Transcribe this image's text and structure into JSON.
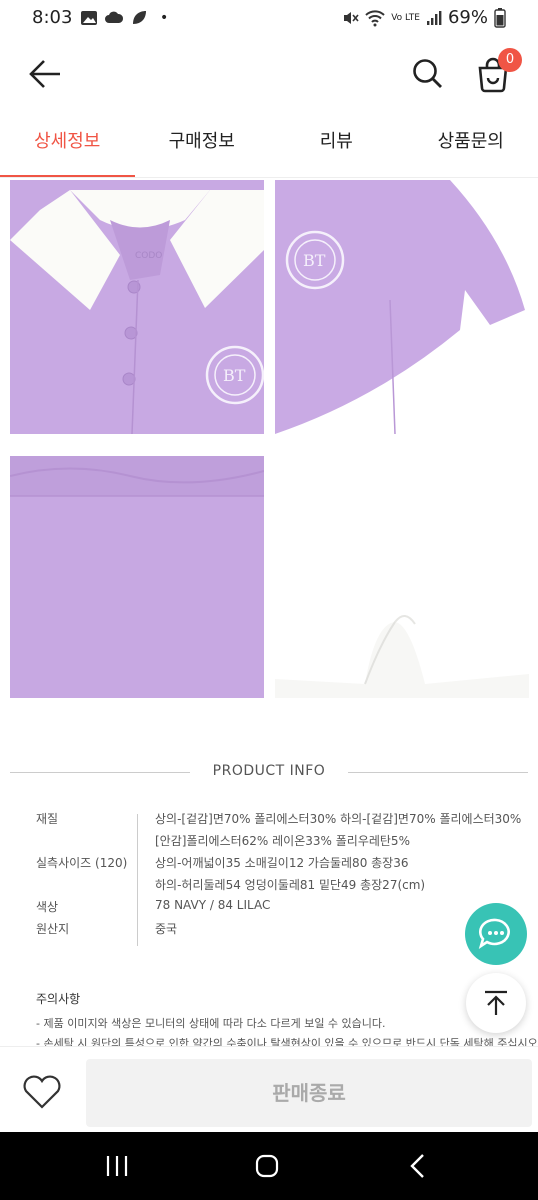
{
  "status_bar": {
    "time": "8:03",
    "dot": "•",
    "battery": "69%",
    "network": "Vo LTE",
    "icons": [
      "gallery-icon",
      "cloud-icon",
      "leaf-icon",
      "mute-icon",
      "wifi-icon",
      "signal-icon",
      "battery-icon"
    ]
  },
  "header": {
    "back_icon": "arrow-left-icon",
    "search_icon": "search-icon",
    "cart_icon": "shopping-bag-icon",
    "cart_count": "0"
  },
  "tabs": [
    {
      "label": "상세정보",
      "active": true
    },
    {
      "label": "구매정보",
      "active": false
    },
    {
      "label": "리뷰",
      "active": false
    },
    {
      "label": "상품문의",
      "active": false
    }
  ],
  "photos": {
    "top_collar_brand": "CODO",
    "emblem_letters": "BT"
  },
  "product_info": {
    "title": "PRODUCT INFO",
    "rows": [
      {
        "key": "재질",
        "value": "상의-[겉감]면70% 폴리에스터30% 하의-[겉감]면70% 폴리에스터30%"
      },
      {
        "key": "",
        "value": "[안감]폴리에스터62% 레이온33% 폴리우레탄5%"
      },
      {
        "key": "실측사이즈 (120)",
        "value": "상의-어깨넓이35 소매길이12 가슴둘레80 총장36"
      },
      {
        "key": "",
        "value": "하의-허리둘레54 엉덩이둘레81 밑단49 총장27(cm)"
      },
      {
        "key": "색상",
        "value": "78 NAVY / 84 LILAC"
      },
      {
        "key": "원산지",
        "value": "중국"
      }
    ]
  },
  "notice": {
    "title": "주의사항",
    "lines": [
      "- 제품 이미지와 색상은 모니터의 상태에 따라 다소 다르게 보일 수 있습니다.",
      "- 손세탁 시 원단의 특성으로 인한 약간의 수축이나 탈색현상이 있을 수 있으므로 반드시 단독 세탁해 주십시오."
    ]
  },
  "fab": {
    "chat_icon": "chat-bubble-icon",
    "top_icon": "arrow-up-icon"
  },
  "bottom_bar": {
    "like_icon": "heart-icon",
    "sold_label": "판매종료"
  },
  "nav_bar": {
    "icons": [
      "recent-apps-icon",
      "home-icon",
      "back-nav-icon"
    ]
  },
  "colors": {
    "accent": "#f05545",
    "lilac": "#c8a9e3",
    "teal": "#38c3b5"
  }
}
